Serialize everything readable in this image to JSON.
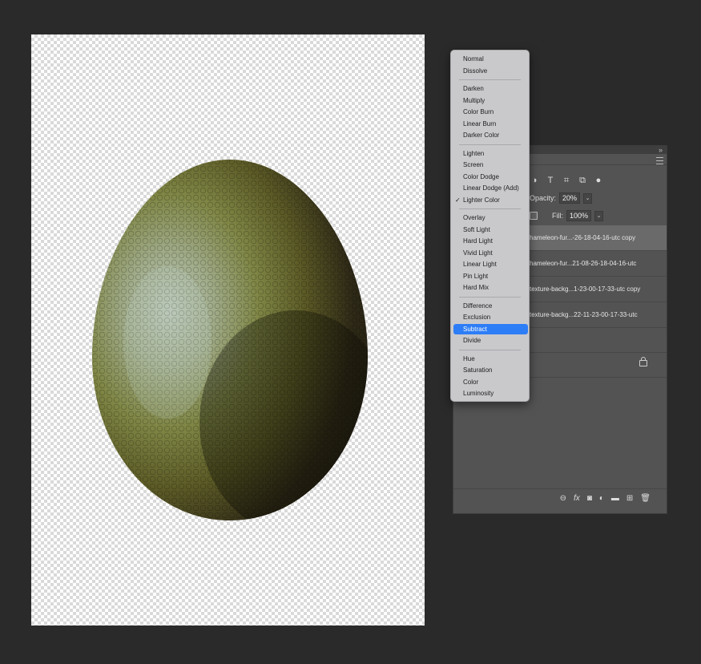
{
  "blend_modes": {
    "groups": [
      [
        "Normal",
        "Dissolve"
      ],
      [
        "Darken",
        "Multiply",
        "Color Burn",
        "Linear Burn",
        "Darker Color"
      ],
      [
        "Lighten",
        "Screen",
        "Color Dodge",
        "Linear Dodge (Add)",
        "Lighter Color"
      ],
      [
        "Overlay",
        "Soft Light",
        "Hard Light",
        "Vivid Light",
        "Linear Light",
        "Pin Light",
        "Hard Mix"
      ],
      [
        "Difference",
        "Exclusion",
        "Subtract",
        "Divide"
      ],
      [
        "Hue",
        "Saturation",
        "Color",
        "Luminosity"
      ]
    ],
    "checked": "Lighter Color",
    "highlighted": "Subtract",
    "check_glyph": "✓"
  },
  "layers_panel": {
    "opacity_label": "Opacity:",
    "opacity_value": "20%",
    "fill_label": "Fill:",
    "fill_value": "100%",
    "layers": [
      {
        "name": "hameleon-fur...-26-18-04-16-utc copy",
        "selected": true
      },
      {
        "name": "hameleon-fur...21-08-26-18-04-16-utc",
        "selected": false
      },
      {
        "name": "texture-backg...1-23-00-17-33-utc copy",
        "selected": false
      },
      {
        "name": "texture-backg...22-11-23-00-17-33-utc",
        "selected": false
      }
    ],
    "filter_icons": [
      "adjustment-filter-icon",
      "type-filter-icon",
      "shape-filter-icon",
      "smart-object-filter-icon",
      "filter-toggle-icon"
    ],
    "bottom_icons": [
      "link-layers-icon",
      "fx-icon",
      "add-mask-icon",
      "adjustment-layer-icon",
      "new-group-icon",
      "new-layer-icon",
      "trash-icon"
    ]
  },
  "colors": {
    "background": "#2a2a2a",
    "panel": "#535353",
    "menu": "#c9c9cc",
    "highlight": "#2d7df6"
  }
}
